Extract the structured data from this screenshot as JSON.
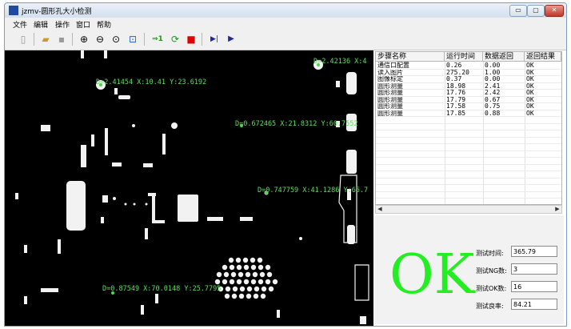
{
  "window": {
    "title": "jzmv-圆形孔大小检测",
    "buttons": [
      "▭",
      "▢",
      "✕"
    ]
  },
  "menu": [
    "文件",
    "编辑",
    "操作",
    "窗口",
    "帮助"
  ],
  "toolbar_icons": [
    "new-icon",
    "open-icon",
    "save-icon",
    "zoom-in-icon",
    "zoom-out-icon",
    "zoom-fit-icon",
    "zoom-actual-icon",
    "run-once-icon",
    "loop-icon",
    "stop-icon",
    "step-icon",
    "play-icon"
  ],
  "toolbar_glyphs": {
    "run_once": "⇒1",
    "loop": "⟳",
    "stop": "■",
    "step": "▶|",
    "play": "▶"
  },
  "captions": [
    {
      "text": "D=2.41454 X:10.41 Y:23.6192"
    },
    {
      "text": "D=2.42136 X:4"
    },
    {
      "text": "D=0.672465 X:21.8312 Y:60.7552"
    },
    {
      "text": "D=0.747759 X:41.1286 Y:65.7"
    },
    {
      "text": "D=0.87549 X:70.0148 Y:25.7795"
    }
  ],
  "table": {
    "headers": [
      "步骤名称",
      "运行时间",
      "数据返回",
      "返回结果"
    ],
    "rows": [
      [
        "通信口配置",
        "0.26",
        "0.00",
        "OK"
      ],
      [
        "读入图片",
        "275.20",
        "1.00",
        "OK"
      ],
      [
        "图像标定",
        "0.37",
        "0.00",
        "OK"
      ],
      [
        "圆形测量",
        "18.98",
        "2.41",
        "OK"
      ],
      [
        "圆形测量",
        "17.76",
        "2.42",
        "OK"
      ],
      [
        "圆形测量",
        "17.79",
        "0.67",
        "OK"
      ],
      [
        "圆形测量",
        "17.58",
        "0.75",
        "OK"
      ],
      [
        "圆形测量",
        "17.85",
        "0.88",
        "OK"
      ]
    ]
  },
  "scroll": {
    "left": "◀",
    "right": "▶"
  },
  "result": {
    "text": "OK",
    "color": "#22ee22"
  },
  "stats": [
    {
      "label": "测试时间:",
      "value": "365.79"
    },
    {
      "label": "测试NG数:",
      "value": "3"
    },
    {
      "label": "测试OK数:",
      "value": "16"
    },
    {
      "label": "测试良率:",
      "value": "84.21"
    }
  ]
}
